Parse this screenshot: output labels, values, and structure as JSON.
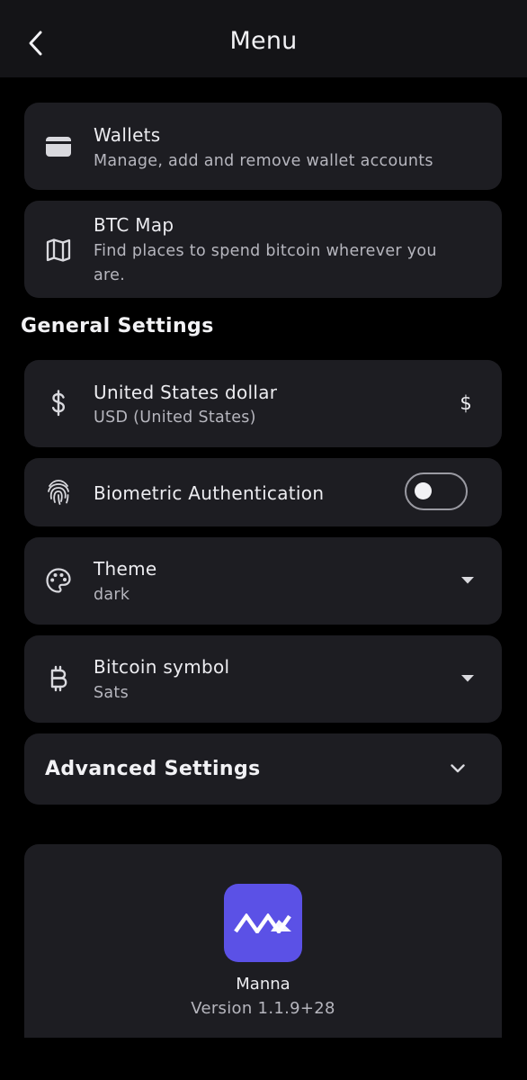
{
  "header": {
    "title": "Menu",
    "back_icon": "chevron-left-icon"
  },
  "items": {
    "wallets": {
      "title": "Wallets",
      "subtitle": "Manage, add and remove wallet accounts",
      "icon": "wallet-icon"
    },
    "btc_map": {
      "title": "BTC Map",
      "subtitle": "Find places to spend bitcoin wherever you are.",
      "icon": "map-icon"
    }
  },
  "general_settings": {
    "title": "General Settings",
    "currency": {
      "title": "United States dollar",
      "subtitle": "USD (United States)",
      "symbol": "$",
      "icon": "dollar-icon"
    },
    "biometric": {
      "title": "Biometric Authentication",
      "enabled": false,
      "icon": "fingerprint-icon"
    },
    "theme": {
      "title": "Theme",
      "value": "dark",
      "icon": "palette-icon"
    },
    "bitcoin_symbol": {
      "title": "Bitcoin symbol",
      "value": "Sats",
      "icon": "bitcoin-icon"
    }
  },
  "advanced_settings": {
    "title": "Advanced Settings",
    "expanded": false
  },
  "about": {
    "app_name": "Manna",
    "version": "Version 1.1.9+28"
  },
  "colors": {
    "background": "#000000",
    "card": "#1d1d22",
    "appbar": "#141417",
    "accent": "#5b51e6",
    "text_primary": "#ececf0",
    "text_secondary": "#b6b6be"
  }
}
